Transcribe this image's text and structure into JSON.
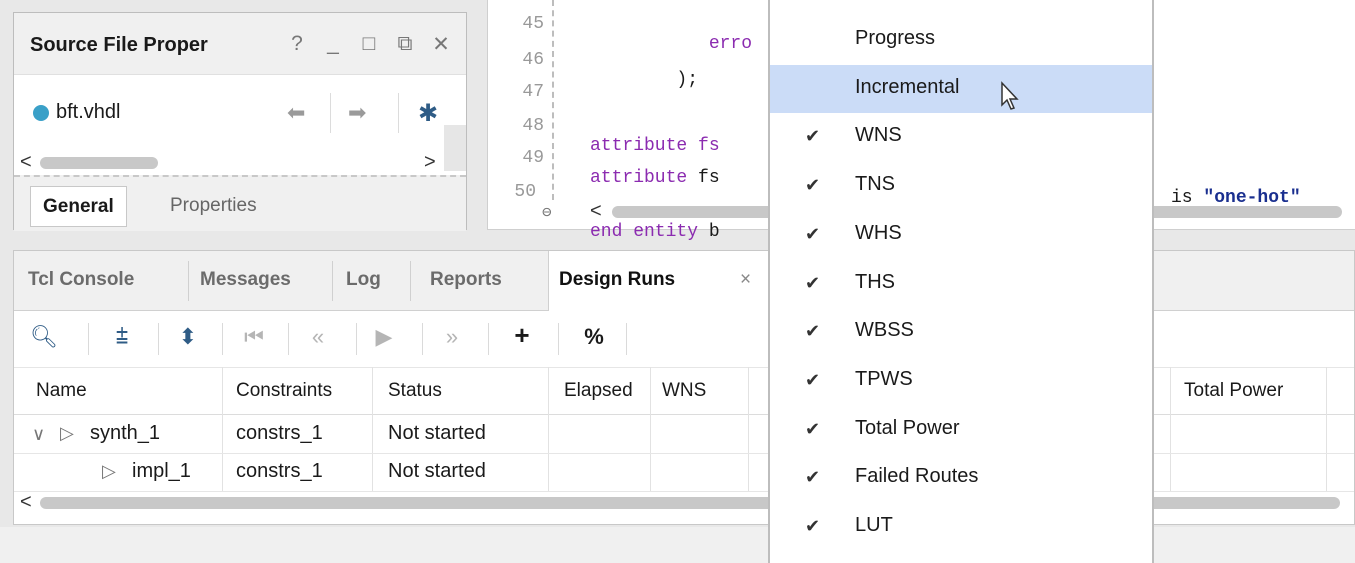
{
  "source_panel": {
    "title": "Source File Proper",
    "controls": [
      "?",
      "_",
      "□",
      "⧉",
      "✕"
    ],
    "file_name": "bft.vhdl",
    "tabs": {
      "general": "General",
      "properties": "Properties"
    }
  },
  "editor": {
    "lines": [
      {
        "num": "45",
        "code": "           erro"
      },
      {
        "num": "46",
        "code": "        );"
      },
      {
        "num": "47",
        "code": ""
      },
      {
        "num": "48",
        "code_kw": "attribute",
        "code_rest": " fs"
      },
      {
        "num": "49",
        "code_kw": "attribute",
        "code_rest": " fs",
        "code_tail_kw": "is",
        "code_tail_str": "\"one-hot\""
      },
      {
        "num": "50",
        "code_kw": "end entity",
        "code_rest": " b"
      }
    ]
  },
  "bottom_panel": {
    "tabs": [
      "Tcl Console",
      "Messages",
      "Log",
      "Reports",
      "Design Runs"
    ],
    "active_tab": "Design Runs",
    "close_symbol": "×",
    "toolbar": [
      "search",
      "collapse-all",
      "expand-all",
      "first",
      "previous",
      "play",
      "next",
      "add",
      "percent"
    ],
    "columns": [
      "Name",
      "Constraints",
      "Status",
      "Elapsed",
      "WNS",
      "Total Power"
    ],
    "rows": [
      {
        "name": "synth_1",
        "constraints": "constrs_1",
        "status": "Not started"
      },
      {
        "name": "impl_1",
        "constraints": "constrs_1",
        "status": "Not started"
      }
    ]
  },
  "context_menu": {
    "items": [
      {
        "label": "Progress",
        "checked": false
      },
      {
        "label": "Incremental",
        "checked": false,
        "highlighted": true
      },
      {
        "label": "WNS",
        "checked": true
      },
      {
        "label": "TNS",
        "checked": true
      },
      {
        "label": "WHS",
        "checked": true
      },
      {
        "label": "THS",
        "checked": true
      },
      {
        "label": "WBSS",
        "checked": true
      },
      {
        "label": "TPWS",
        "checked": true
      },
      {
        "label": "Total Power",
        "checked": true
      },
      {
        "label": "Failed Routes",
        "checked": true
      },
      {
        "label": "LUT",
        "checked": true
      }
    ],
    "check_glyph": "✔"
  },
  "colors": {
    "accent": "#2f5c86",
    "highlight": "#cbdcf7",
    "file_dot": "#3aa0c8",
    "keyword": "#8b2bb0",
    "string": "#1a2f8f"
  }
}
